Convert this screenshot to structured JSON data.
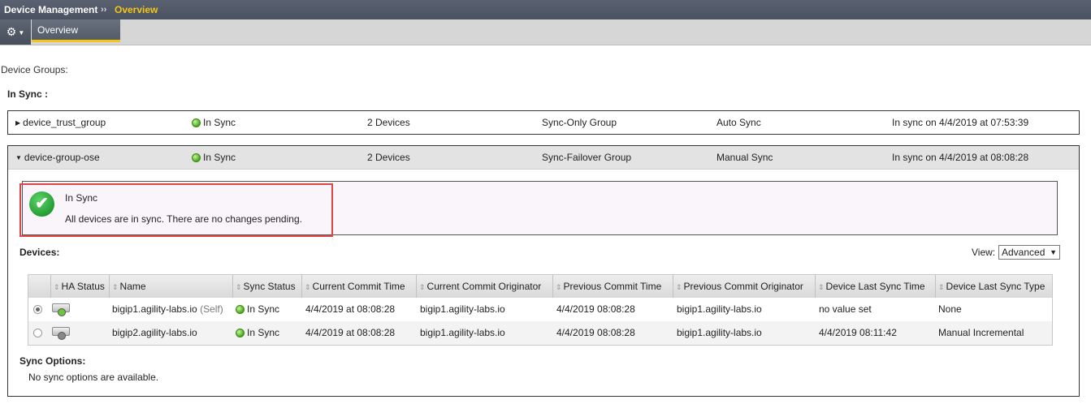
{
  "header": {
    "section": "Device Management",
    "separator": "››",
    "page": "Overview"
  },
  "tabs": {
    "overview": "Overview"
  },
  "labels": {
    "device_groups": "Device Groups:",
    "in_sync_heading": "In Sync :"
  },
  "groups": [
    {
      "name": "device_trust_group",
      "status": "In Sync",
      "devices": "2 Devices",
      "type": "Sync-Only Group",
      "sync_mode": "Auto Sync",
      "last": "In sync on 4/4/2019 at 07:53:39"
    },
    {
      "name": "device-group-ose",
      "status": "In Sync",
      "devices": "2 Devices",
      "type": "Sync-Failover Group",
      "sync_mode": "Manual Sync",
      "last": "In sync on 4/4/2019 at 08:08:28"
    }
  ],
  "message": {
    "title": "In Sync",
    "text": "All devices are in sync. There are no changes pending."
  },
  "devices": {
    "label": "Devices:",
    "view_label": "View:",
    "view_value": "Advanced",
    "columns": [
      "HA Status",
      "Name",
      "Sync Status",
      "Current Commit Time",
      "Current Commit Originator",
      "Previous Commit Time",
      "Previous Commit Originator",
      "Device Last Sync Time",
      "Device Last Sync Type"
    ],
    "rows": [
      {
        "name": "bigip1.agility-labs.io",
        "self": "(Self)",
        "sync": "In Sync",
        "cur_time": "4/4/2019 at 08:08:28",
        "cur_orig": "bigip1.agility-labs.io",
        "prev_time": "4/4/2019 08:08:28",
        "prev_orig": "bigip1.agility-labs.io",
        "last_sync": "no value set",
        "last_type": "None",
        "led_color": "#6cc63a"
      },
      {
        "name": "bigip2.agility-labs.io",
        "self": "",
        "sync": "In Sync",
        "cur_time": "4/4/2019 at 08:08:28",
        "cur_orig": "bigip1.agility-labs.io",
        "prev_time": "4/4/2019 08:08:28",
        "prev_orig": "bigip1.agility-labs.io",
        "last_sync": "4/4/2019 08:11:42",
        "last_type": "Manual Incremental",
        "led_color": "#888888"
      }
    ]
  },
  "sync_options": {
    "label": "Sync Options:",
    "text": "No sync options are available."
  }
}
